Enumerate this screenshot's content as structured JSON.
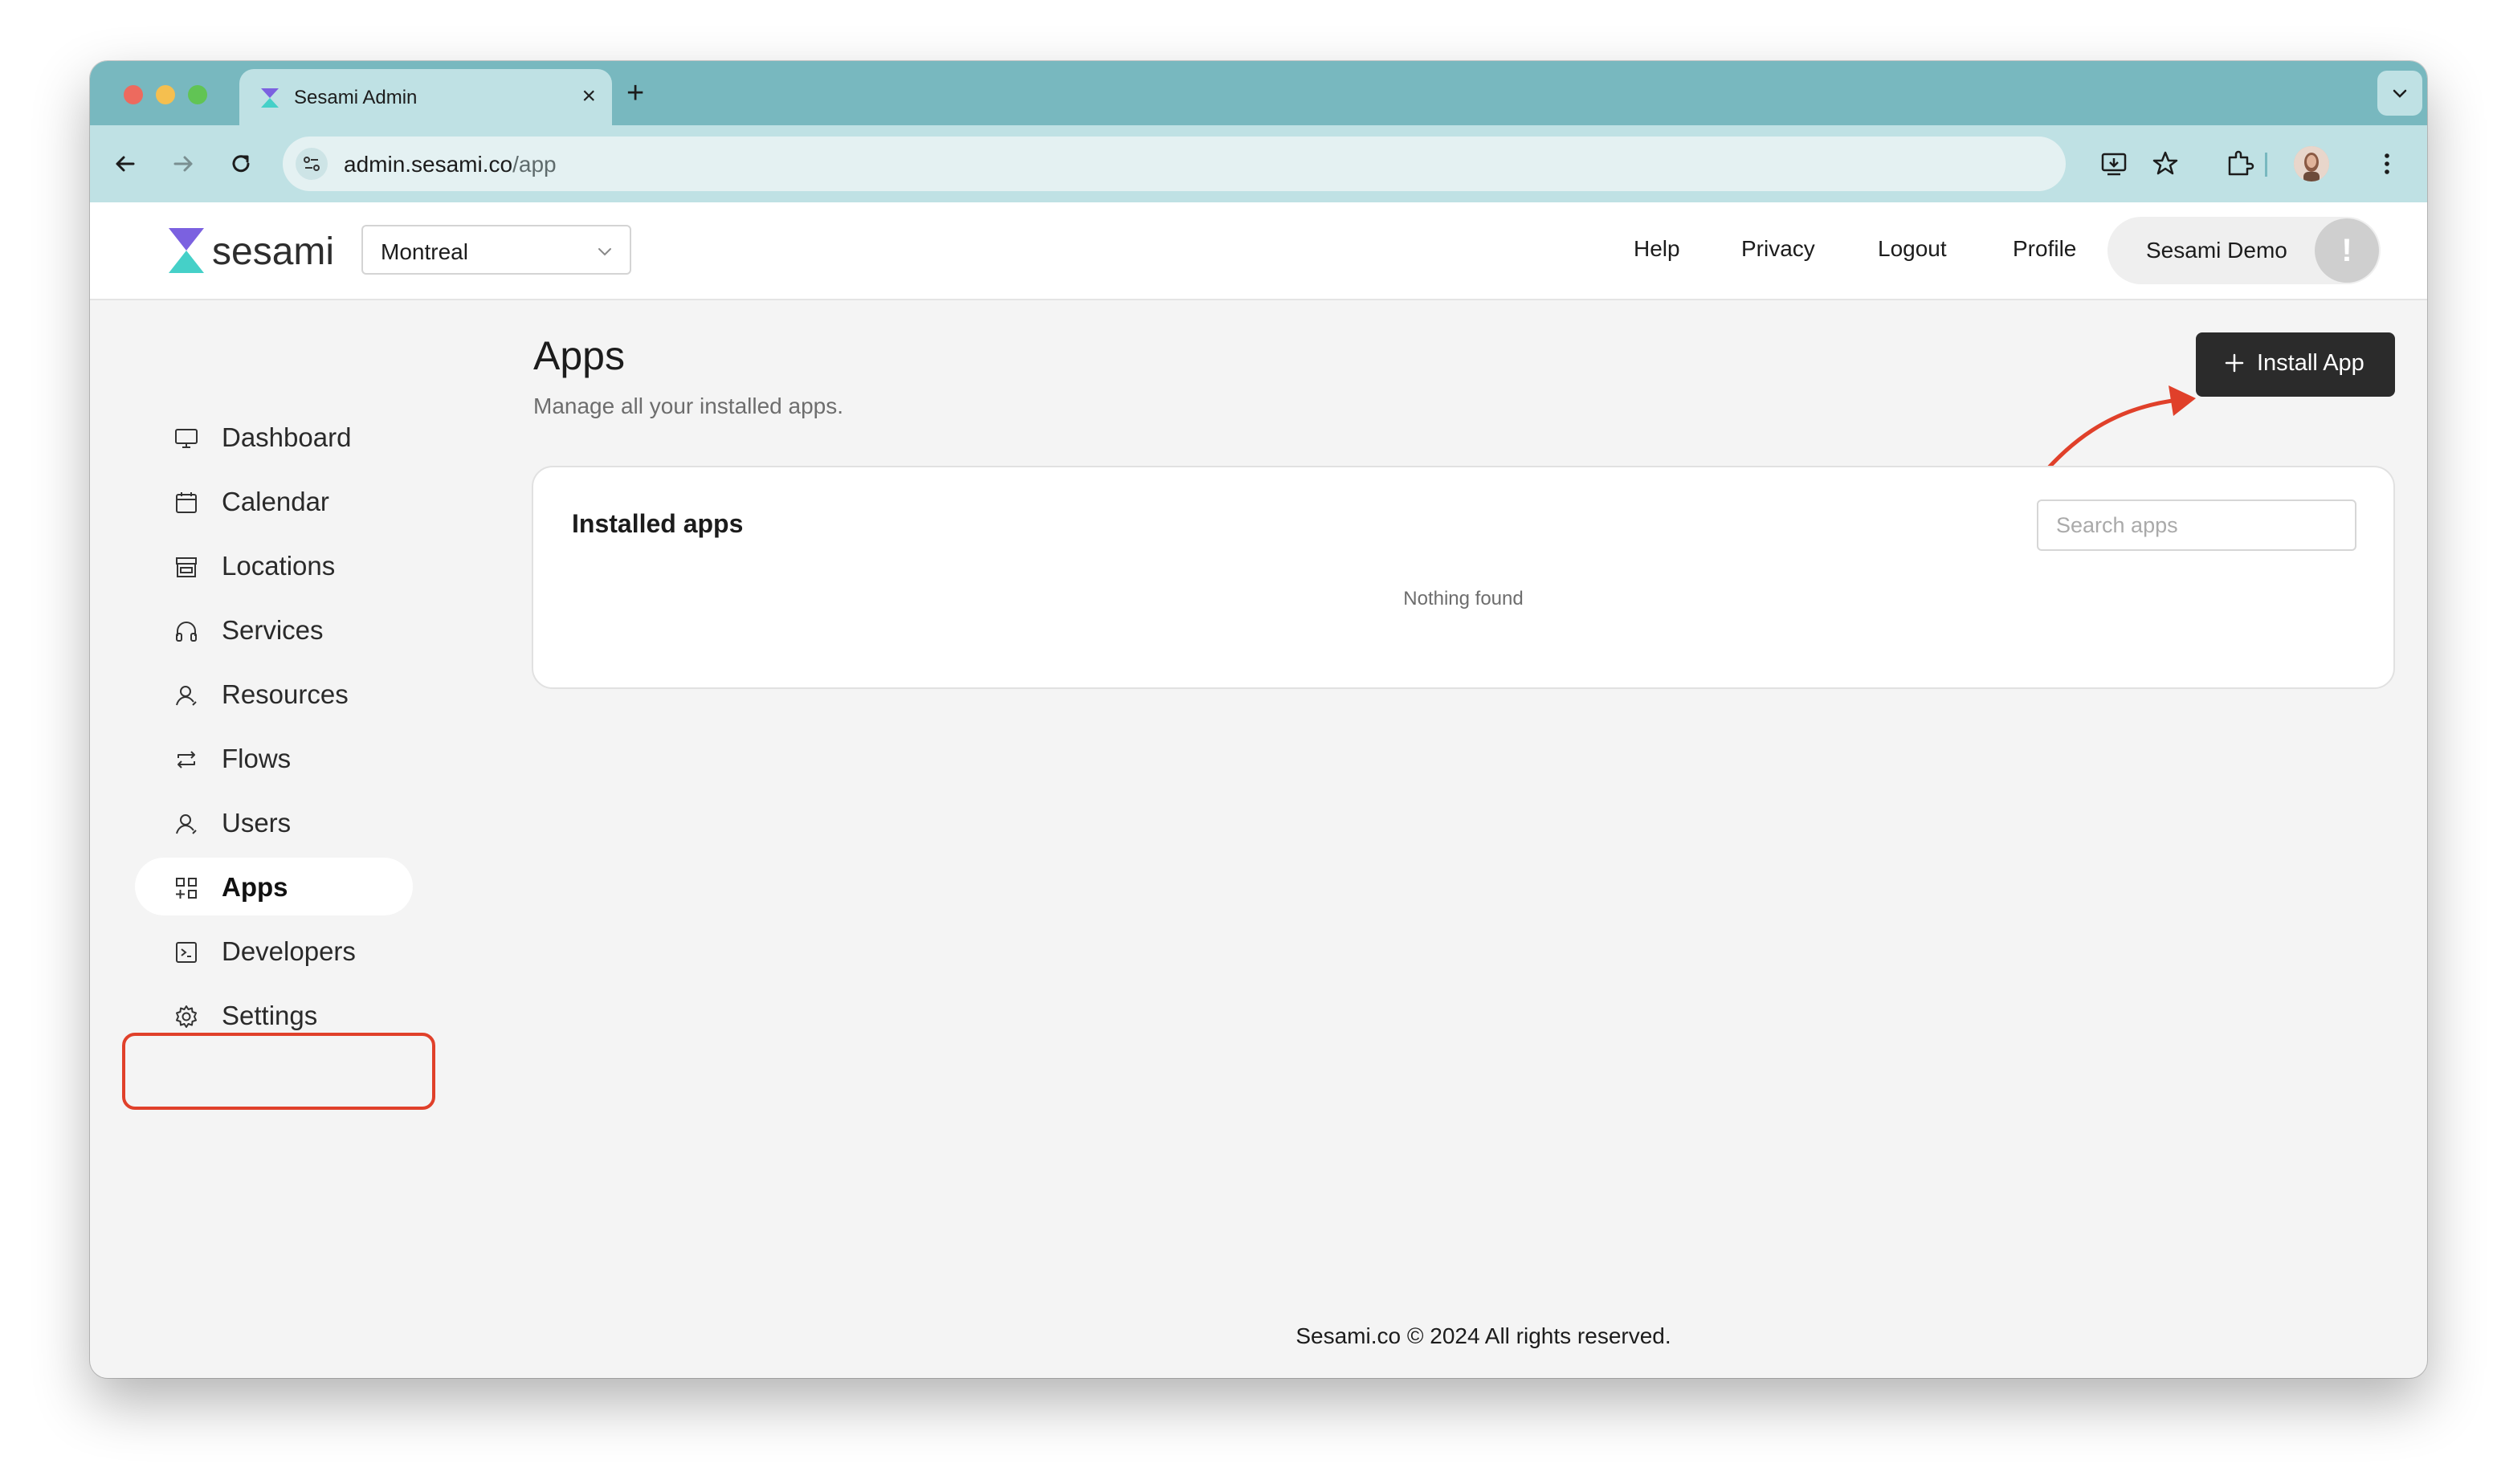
{
  "browser": {
    "tab_title": "Sesami Admin",
    "url_host": "admin.sesami.co",
    "url_path": "/app",
    "new_tab_label": "+",
    "close_tab_label": "×"
  },
  "header": {
    "logo_text": "sesami",
    "location": "Montreal",
    "links": {
      "help": "Help",
      "privacy": "Privacy",
      "logout": "Logout",
      "profile": "Profile"
    },
    "user_name": "Sesami Demo",
    "user_badge": "!"
  },
  "sidebar": {
    "items": [
      {
        "label": "Dashboard",
        "icon": "monitor-icon"
      },
      {
        "label": "Calendar",
        "icon": "calendar-icon"
      },
      {
        "label": "Locations",
        "icon": "store-icon"
      },
      {
        "label": "Services",
        "icon": "headphones-icon"
      },
      {
        "label": "Resources",
        "icon": "person-icon"
      },
      {
        "label": "Flows",
        "icon": "repeat-icon"
      },
      {
        "label": "Users",
        "icon": "person-icon"
      },
      {
        "label": "Apps",
        "icon": "grid-plus-icon",
        "active": true
      },
      {
        "label": "Developers",
        "icon": "terminal-icon"
      },
      {
        "label": "Settings",
        "icon": "gear-icon"
      }
    ]
  },
  "main": {
    "title": "Apps",
    "subtitle": "Manage all your installed apps.",
    "install_button": "Install App",
    "card": {
      "title": "Installed apps",
      "search_placeholder": "Search apps",
      "empty_text": "Nothing found"
    }
  },
  "footer": {
    "text": "Sesami.co © 2024  All rights reserved."
  },
  "colors": {
    "tab_strip": "#78b8bf",
    "toolbar": "#bfe1e4",
    "accent_dark": "#2b2b2b",
    "annotation_red": "#e0402a"
  }
}
